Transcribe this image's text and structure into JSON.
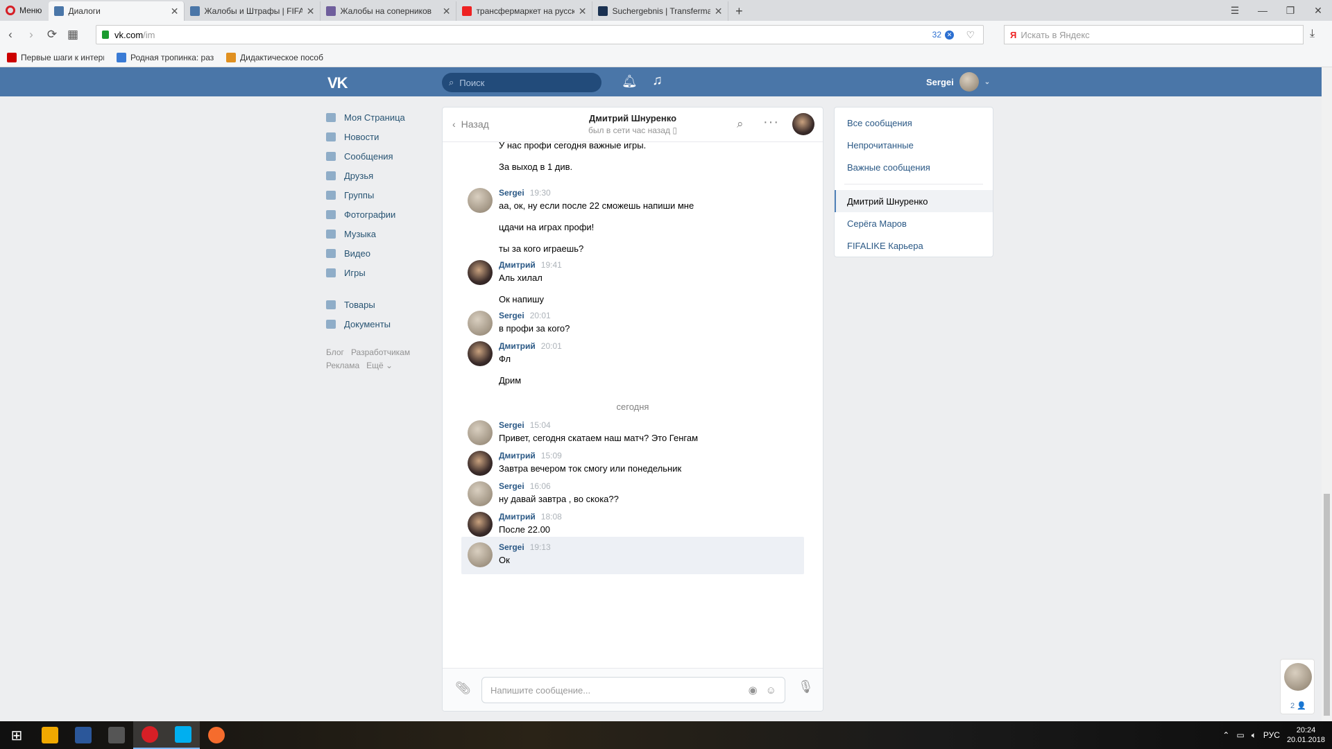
{
  "browser": {
    "menu_label": "Меню",
    "tabs": [
      {
        "title": "Диалоги",
        "active": true,
        "color": "#4a76a8"
      },
      {
        "title": "Жалобы и Штрафы | FIFALIKE",
        "active": false,
        "color": "#4a76a8"
      },
      {
        "title": "Жалобы на соперников",
        "active": false,
        "color": "#6f5e9c"
      },
      {
        "title": "трансфермаркет на русском",
        "active": false,
        "color": "#e22"
      },
      {
        "title": "Suchergebnis | Transfermarkt",
        "active": false,
        "color": "#1a3151"
      }
    ],
    "url_host": "vk.com",
    "url_path": "/im",
    "block_count": "32",
    "yandex_placeholder": "Искать в Яндекс",
    "bookmarks": [
      {
        "label": "Первые шаги к интернету",
        "color": "#c00"
      },
      {
        "label": "Родная тропинка: развитие",
        "color": "#3a7bd5"
      },
      {
        "label": "Дидактическое пособие",
        "color": "#e09020"
      }
    ]
  },
  "vk": {
    "logo": "VK",
    "search_placeholder": "Поиск",
    "user_name": "Sergei",
    "nav": [
      "Моя Страница",
      "Новости",
      "Сообщения",
      "Друзья",
      "Группы",
      "Фотографии",
      "Музыка",
      "Видео",
      "Игры"
    ],
    "nav2": [
      "Товары",
      "Документы"
    ],
    "footer": [
      "Блог",
      "Разработчикам",
      "Реклама",
      "Ещё ⌄"
    ]
  },
  "chat": {
    "back_label": "Назад",
    "peer_name": "Дмитрий Шнуренко",
    "peer_status": "был в сети час назад",
    "top_fragment": "У нас профи сегодня важные игры.",
    "top_cont": "За выход в 1 див.",
    "groups": [
      {
        "author": "Sergei",
        "time": "19:30",
        "who": "me",
        "lines": [
          "аа, ок, ну если после 22 сможешь напиши мне",
          "цдачи на играх профи!",
          "ты за кого играешь?"
        ]
      },
      {
        "author": "Дмитрий",
        "time": "19:41",
        "who": "peer",
        "lines": [
          "Аль хилал",
          "Ок напишу"
        ]
      },
      {
        "author": "Sergei",
        "time": "20:01",
        "who": "me",
        "lines": [
          "в профи за кого?"
        ]
      },
      {
        "author": "Дмитрий",
        "time": "20:01",
        "who": "peer",
        "lines": [
          "Фл",
          "Дрим"
        ]
      }
    ],
    "date_separator": "сегодня",
    "groups_today": [
      {
        "author": "Sergei",
        "time": "15:04",
        "who": "me",
        "lines": [
          "Привет, сегодня скатаем наш матч? Это Генгам"
        ]
      },
      {
        "author": "Дмитрий",
        "time": "15:09",
        "who": "peer",
        "lines": [
          "Завтра вечером ток смогу или понедельник"
        ]
      },
      {
        "author": "Sergei",
        "time": "16:06",
        "who": "me",
        "lines": [
          "ну давай завтра , во скока??"
        ]
      },
      {
        "author": "Дмитрий",
        "time": "18:08",
        "who": "peer",
        "lines": [
          "После 22.00"
        ]
      },
      {
        "author": "Sergei",
        "time": "19:13",
        "who": "me",
        "lines": [
          "Ок"
        ],
        "highlight": true
      }
    ],
    "compose_placeholder": "Напишите сообщение..."
  },
  "right_menu": {
    "filters": [
      "Все сообщения",
      "Непрочитанные",
      "Важные сообщения"
    ],
    "dialogs": [
      {
        "label": "Дмитрий Шнуренко",
        "active": true
      },
      {
        "label": "Серёга Маров",
        "active": false
      },
      {
        "label": "FIFALIKE Карьера",
        "active": false
      }
    ]
  },
  "chat_widget_count": "2 👤",
  "taskbar": {
    "apps": [
      {
        "name": "aimp",
        "color": "#f0a800"
      },
      {
        "name": "word",
        "color": "#2b579a"
      },
      {
        "name": "upload",
        "color": "#555"
      },
      {
        "name": "opera",
        "color": "#d61f26",
        "active": true
      },
      {
        "name": "skype",
        "color": "#00aff0",
        "active": true
      },
      {
        "name": "origin",
        "color": "#f56c2d"
      }
    ],
    "lang": "РУС",
    "time": "20:24",
    "date": "20.01.2018"
  }
}
